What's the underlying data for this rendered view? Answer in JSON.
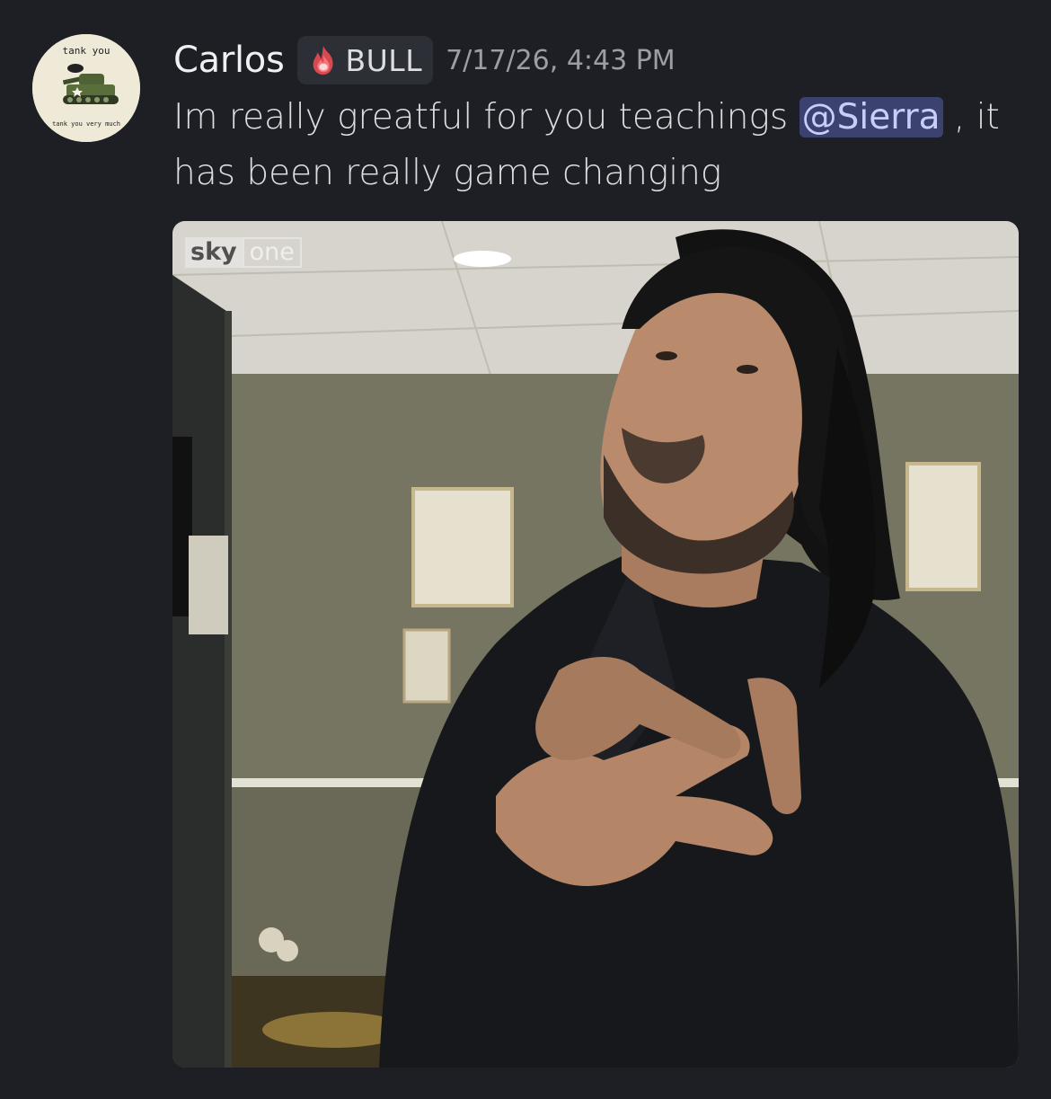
{
  "author": {
    "name": "Carlos",
    "avatar_text_top": "tank you",
    "avatar_text_bottom": "tank you very much",
    "role_icon": "fire-icon",
    "role_label": "BULL",
    "timestamp": "7/17/26, 4:43 PM"
  },
  "message": {
    "text_before": "Im really greatful for you teachings ",
    "mention": "@Sierra",
    "text_after": " , it has been really game changing"
  },
  "attachment": {
    "watermark_left": "sky",
    "watermark_right": "one"
  },
  "colors": {
    "background": "#1e1f25",
    "mention_bg": "#3c4270",
    "mention_text": "#c9cdfb",
    "username": "#eef0f3",
    "timestamp": "#9b9ea6"
  }
}
